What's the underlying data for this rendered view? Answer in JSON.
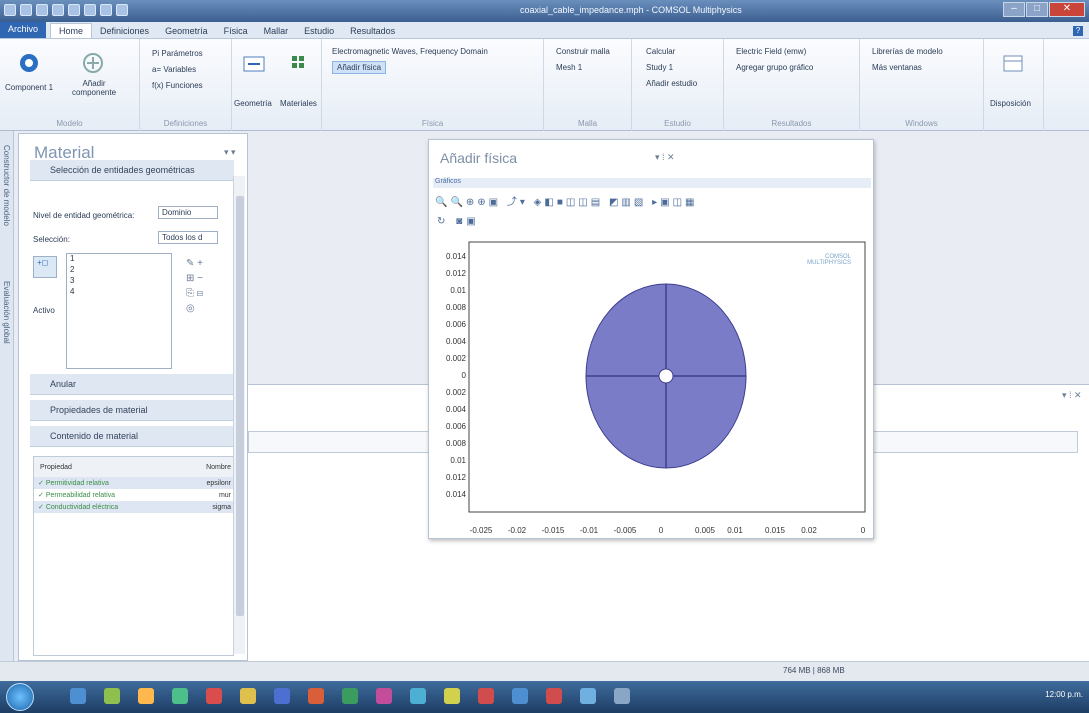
{
  "window": {
    "title": "coaxial_cable_impedance.mph - COMSOL Multiphysics"
  },
  "ribbon": {
    "tabs": [
      "Archivo",
      "Home",
      "Definiciones",
      "Geometría",
      "Física",
      "Mallar",
      "Estudio",
      "Resultados"
    ],
    "active_tab": "Home",
    "groups": {
      "modelo": {
        "label": "Modelo",
        "component": "Component 1",
        "add_component": "Añadir componente"
      },
      "definiciones": {
        "label": "Definiciones",
        "parametros": "Pi Parámetros",
        "variables": "a= Variables",
        "funciones": "f(x) Funciones"
      },
      "geometria": {
        "label": "Geometría"
      },
      "materiales": {
        "label": "Materiales"
      },
      "fisica": {
        "label": "Física",
        "physics": "Electromagnetic Waves, Frequency Domain",
        "add_physics": "Añadir física"
      },
      "malla": {
        "label": "Malla",
        "build": "Construir malla",
        "mesh": "Mesh 1"
      },
      "estudio": {
        "label": "Estudio",
        "compute": "Calcular",
        "study": "Study 1",
        "add_study": "Añadir estudio"
      },
      "resultados": {
        "label": "Resultados",
        "field": "Electric Field (emw)",
        "add_group": "Agregar grupo gráfico"
      },
      "windows": {
        "label": "Windows",
        "library": "Librerías de modelo",
        "more": "Más ventanas"
      },
      "layout": {
        "label": "Disposición"
      }
    }
  },
  "left_strip": {
    "builder": "Constructor de modelo",
    "global": "Evaluación global"
  },
  "material_panel": {
    "title": "Material",
    "sections": {
      "geom": "Selección de entidades geométricas",
      "override": "Anular",
      "props": "Propiedades de material",
      "contents": "Contenido de material"
    },
    "level_label": "Nivel de entidad geométrica:",
    "level_value": "Dominio",
    "selection_label": "Selección:",
    "selection_value": "Todos los d",
    "active_label": "Activo",
    "selection_items": [
      "1",
      "2",
      "3",
      "4"
    ],
    "table_headers": {
      "property": "Propiedad",
      "name": "Nombre"
    },
    "table_rows": [
      {
        "property": "Permitividad relativa",
        "name": "epsilonr"
      },
      {
        "property": "Permeabilidad relativa",
        "name": "mur"
      },
      {
        "property": "Conductividad eléctrica",
        "name": "sigma"
      }
    ]
  },
  "physics_window": {
    "title": "Añadir física",
    "toolbar_label": "Gráficos",
    "y_ticks": [
      "0.014",
      "0.012",
      "0.01",
      "0.008",
      "0.006",
      "0.004",
      "0.002",
      "0",
      "0.002",
      "0.004",
      "0.006",
      "0.008",
      "0.01",
      "0.012",
      "0.014"
    ],
    "x_ticks": [
      "-0.025",
      "-0.02",
      "-0.015",
      "-0.01",
      "-0.005",
      "0",
      "0.005",
      "0.01",
      "0.015",
      "0.02",
      "0"
    ],
    "logo_text": "COMSOL MULTIPHYSICS"
  },
  "colors": {
    "geometry_fill": "#7b7cc8",
    "geometry_line": "#3e3f8f",
    "accent": "#2f67b3"
  },
  "status": {
    "memory": "764 MB | 868 MB"
  },
  "taskbar": {
    "clock": "12:00 p.m."
  }
}
